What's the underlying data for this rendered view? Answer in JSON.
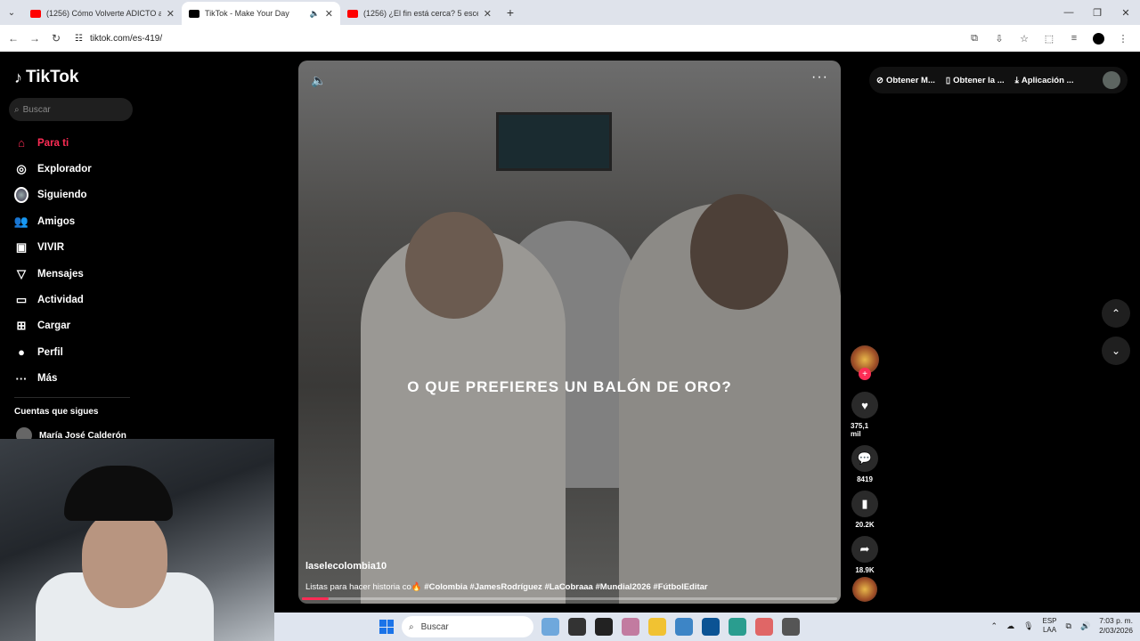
{
  "browser": {
    "tabs": [
      {
        "title": "(1256) Cómo Volverte ADICTO a...",
        "active": false
      },
      {
        "title": "TikTok - Make Your Day",
        "active": true
      },
      {
        "title": "(1256) ¿El fin está cerca? 5 esce...",
        "active": false
      }
    ],
    "url": "tiktok.com/es-419/"
  },
  "sidebar": {
    "logo": "TikTok",
    "search_placeholder": "Buscar",
    "items": [
      {
        "label": "Para ti",
        "icon": "home-icon"
      },
      {
        "label": "Explorador",
        "icon": "compass-icon"
      },
      {
        "label": "Siguiendo",
        "icon": "following-avatar-icon"
      },
      {
        "label": "Amigos",
        "icon": "friends-icon"
      },
      {
        "label": "VIVIR",
        "icon": "live-icon"
      },
      {
        "label": "Mensajes",
        "icon": "send-icon"
      },
      {
        "label": "Actividad",
        "icon": "activity-icon"
      },
      {
        "label": "Cargar",
        "icon": "upload-icon"
      },
      {
        "label": "Perfil",
        "icon": "profile-icon"
      },
      {
        "label": "Más",
        "icon": "more-icon"
      }
    ],
    "following_title": "Cuentas que sigues",
    "following_user": "María José Calderón"
  },
  "header": {
    "items": [
      "Obtener M...",
      "Obtener la ...",
      "Aplicación ..."
    ]
  },
  "video": {
    "caption": "O QUE PREFIERES UN BALÓN DE ORO?",
    "username": "laselecolombia10",
    "description_prefix": "Listas para hacer historia co",
    "hashtags": "#Colombia #JamesRodríguez #LaCobraaa #Mundial2026 #FútbolEditar",
    "progress": 0.05
  },
  "actions": {
    "likes": "375,1 mil",
    "comments": "8419",
    "saves": "20.2K",
    "shares": "18.9K"
  },
  "taskbar": {
    "search": "Buscar",
    "lang_line1": "ESP",
    "lang_line2": "LAA",
    "time": "7:03 p. m.",
    "date": "2/03/2026"
  }
}
